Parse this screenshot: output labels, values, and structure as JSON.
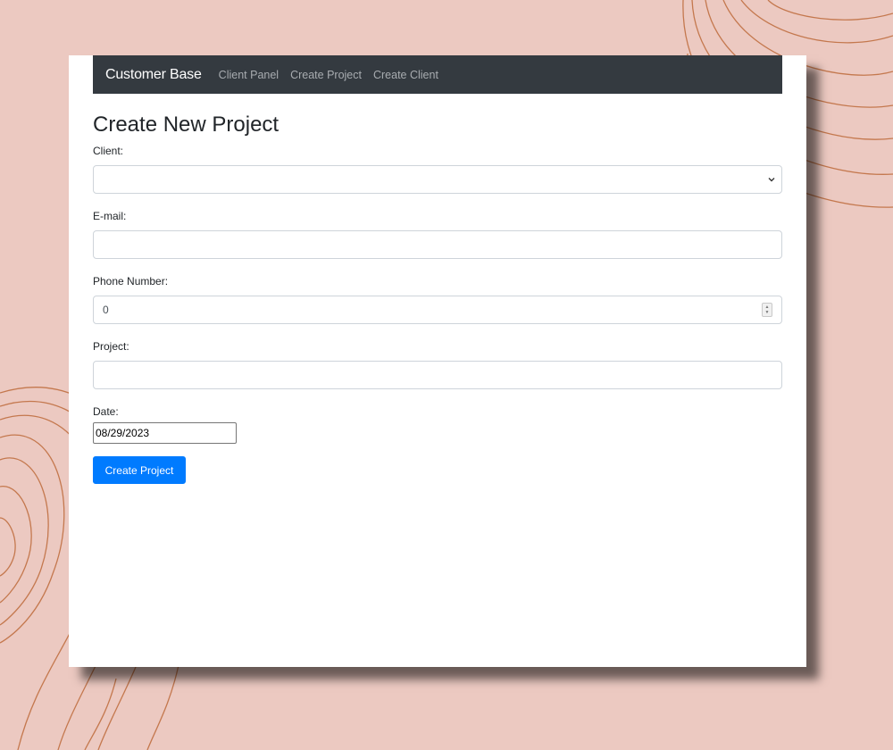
{
  "navbar": {
    "brand": "Customer Base",
    "links": [
      "Client Panel",
      "Create Project",
      "Create Client"
    ]
  },
  "page": {
    "title": "Create New Project"
  },
  "form": {
    "client": {
      "label": "Client:",
      "value": ""
    },
    "email": {
      "label": "E-mail:",
      "value": ""
    },
    "phone": {
      "label": "Phone Number:",
      "value": "0"
    },
    "project": {
      "label": "Project:",
      "value": ""
    },
    "date": {
      "label": "Date:",
      "value": "08/29/2023"
    },
    "submit_label": "Create Project"
  },
  "colors": {
    "background": "#ecc9c1",
    "navbar": "#343a40",
    "primary": "#007bff",
    "decoration": "#c4784e"
  }
}
